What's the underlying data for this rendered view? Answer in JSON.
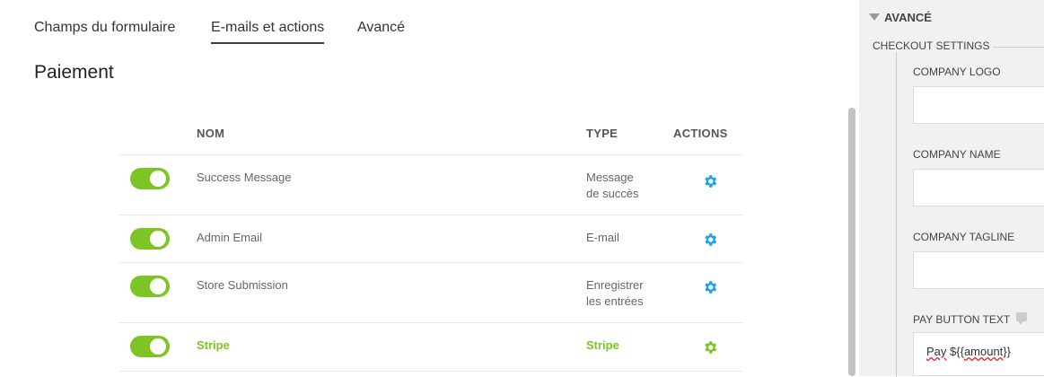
{
  "tabs": [
    {
      "label": "Champs du formulaire",
      "active": false
    },
    {
      "label": "E-mails et actions",
      "active": true
    },
    {
      "label": "Avancé",
      "active": false
    }
  ],
  "page_title": "Paiement",
  "table": {
    "headers": {
      "name": "NOM",
      "type": "TYPE",
      "actions": "ACTIONS"
    },
    "rows": [
      {
        "enabled": true,
        "name": "Success Message",
        "type_line1": "Message",
        "type_line2": "de succès",
        "highlight": false
      },
      {
        "enabled": true,
        "name": "Admin Email",
        "type_line1": "E-mail",
        "type_line2": "",
        "highlight": false
      },
      {
        "enabled": true,
        "name": "Store Submission",
        "type_line1": "Enregistrer",
        "type_line2": "les entrées",
        "highlight": false
      },
      {
        "enabled": true,
        "name": "Stripe",
        "type_line1": "Stripe",
        "type_line2": "",
        "highlight": true
      }
    ]
  },
  "sidebar": {
    "section_title": "AVANCÉ",
    "group_title": "CHECKOUT SETTINGS",
    "fields": {
      "company_logo": {
        "label": "COMPANY LOGO",
        "value": ""
      },
      "company_name": {
        "label": "COMPANY NAME",
        "value": ""
      },
      "company_tagline": {
        "label": "COMPANY TAGLINE",
        "value": ""
      },
      "pay_button_text": {
        "label": "PAY BUTTON TEXT",
        "value_word": "Pay",
        "value_rest": " ${",
        "value_token": "amount",
        "value_end": "}}"
      }
    }
  },
  "colors": {
    "accent_green": "#7cc524",
    "gear_blue": "#1ea1e8",
    "gear_green": "#7cc524"
  }
}
